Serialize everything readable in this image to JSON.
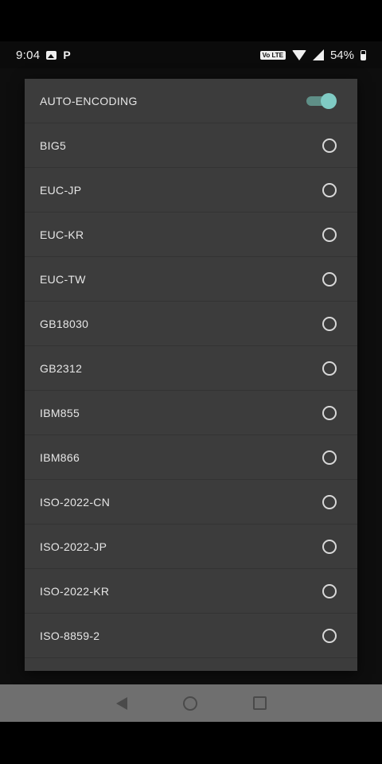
{
  "status_bar": {
    "time": "9:04",
    "network_badge": "Vo LTE",
    "battery": "54%"
  },
  "dialog": {
    "auto_encoding": {
      "label": "AUTO-ENCODING",
      "enabled": true
    },
    "encodings": [
      "BIG5",
      "EUC-JP",
      "EUC-KR",
      "EUC-TW",
      "GB18030",
      "GB2312",
      "IBM855",
      "IBM866",
      "ISO-2022-CN",
      "ISO-2022-JP",
      "ISO-2022-KR",
      "ISO-8859-2"
    ]
  },
  "nav_bar": {
    "icons": [
      "back-icon",
      "home-icon",
      "recents-icon"
    ]
  },
  "colors": {
    "accent": "#80cbc4",
    "dialog_bg": "#3c3c3c",
    "nav_bg": "#6f6f6f"
  }
}
